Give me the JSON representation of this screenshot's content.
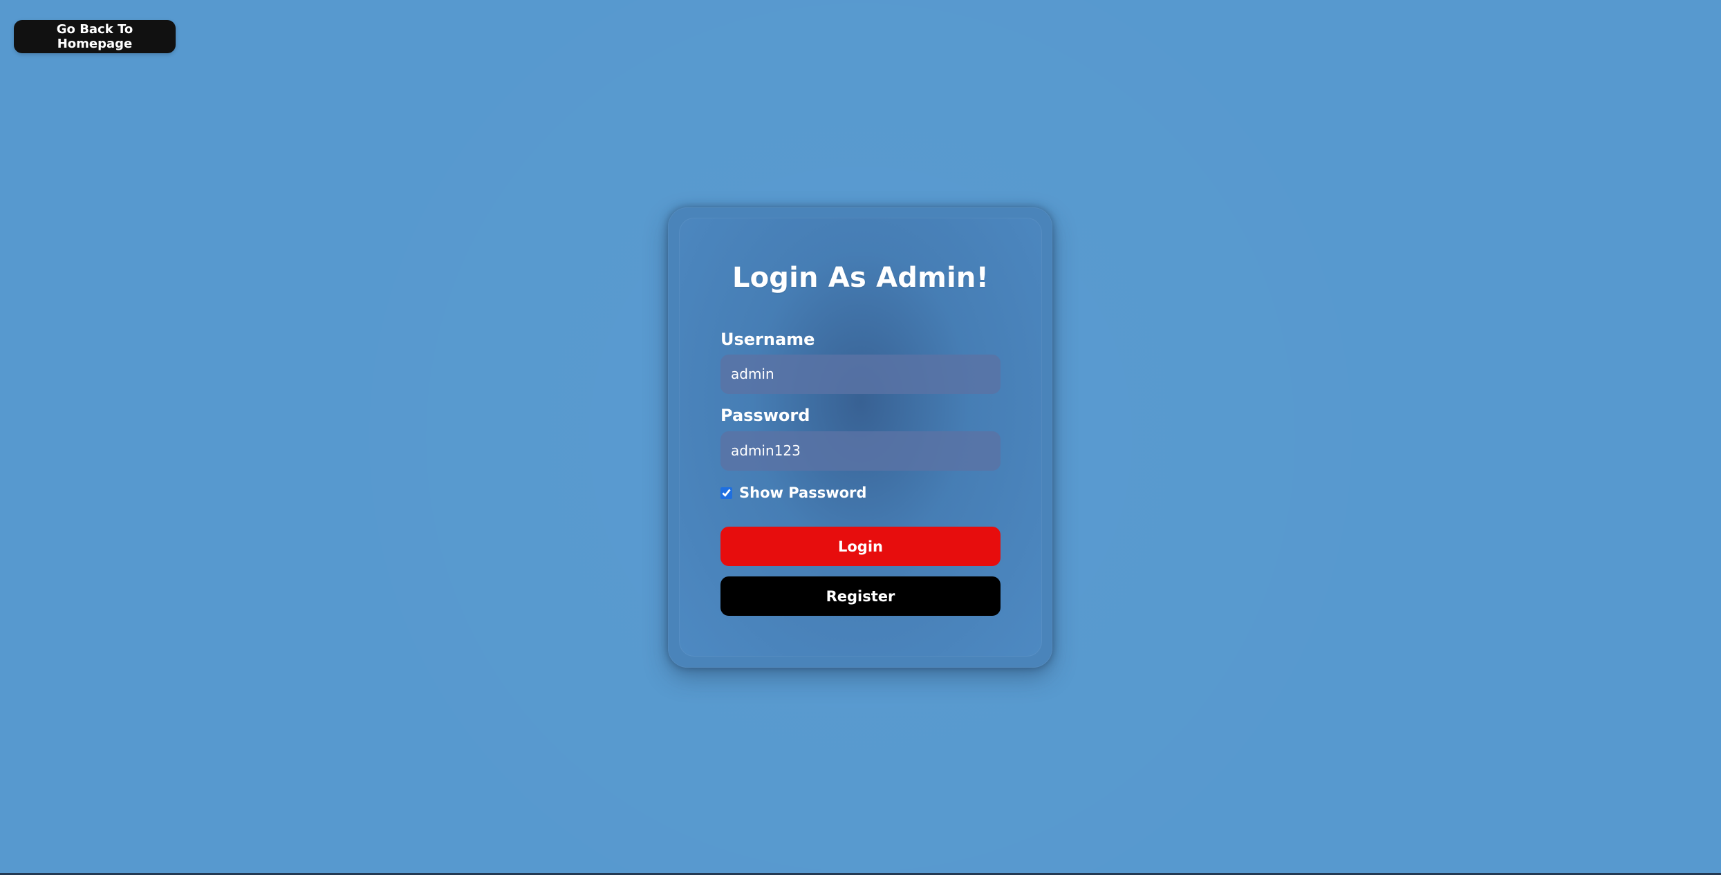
{
  "navigation": {
    "back_button_label": "Go Back To Homepage"
  },
  "login_card": {
    "title": "Login As Admin!",
    "username": {
      "label": "Username",
      "value": "admin"
    },
    "password": {
      "label": "Password",
      "value": "admin123"
    },
    "show_password": {
      "label": "Show Password",
      "checked": true
    },
    "buttons": {
      "login": "Login",
      "register": "Register"
    }
  },
  "colors": {
    "background": "#5799cf",
    "card": "#467db4",
    "login_button": "#e70d0d",
    "register_button": "#000000",
    "back_button": "#111111"
  }
}
